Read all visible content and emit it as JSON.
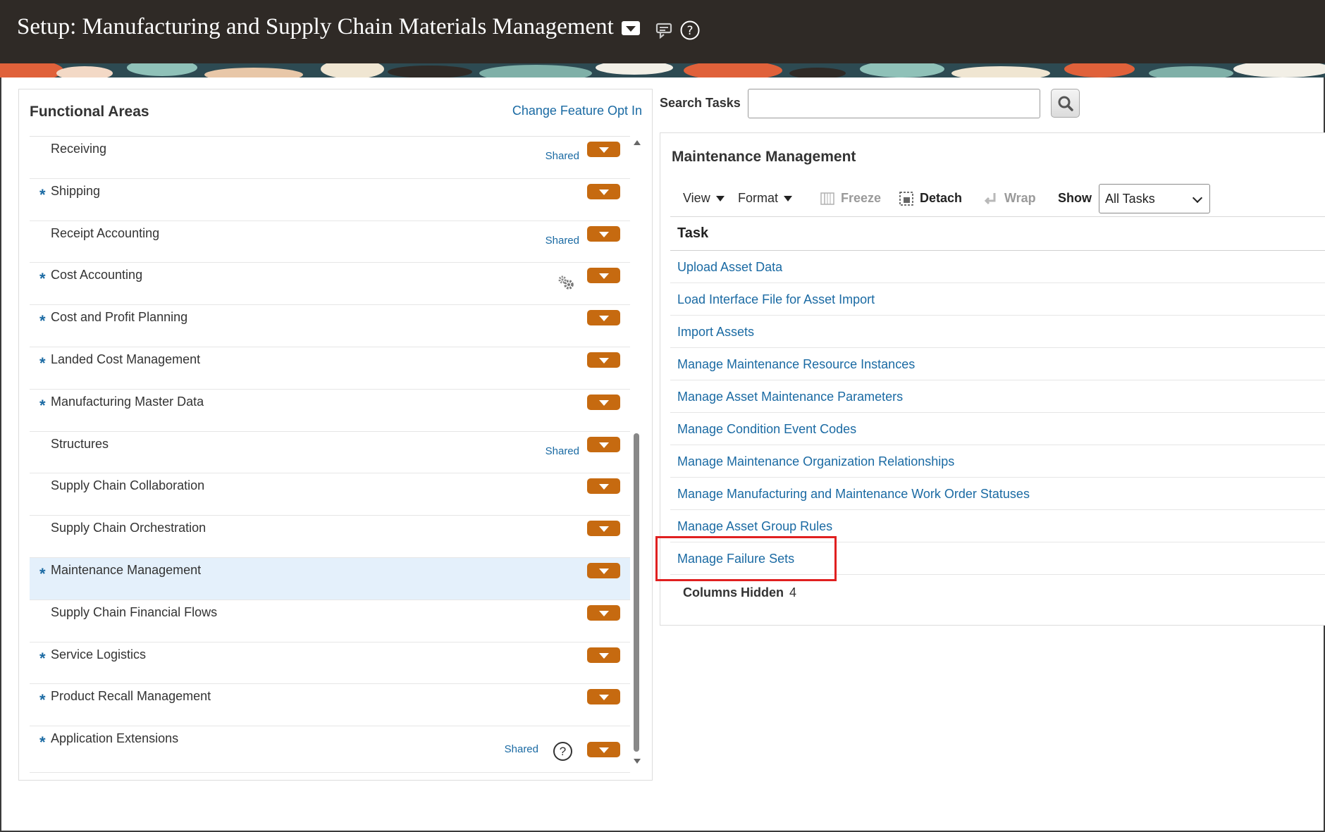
{
  "header": {
    "title": "Setup: Manufacturing and Supply Chain Materials Management",
    "title_dropdown_icon": "caret-down-icon",
    "icons": [
      "tray-icon",
      "help-icon"
    ]
  },
  "functional_areas": {
    "title": "Functional Areas",
    "change_link": "Change Feature Opt In",
    "shared_label": "Shared",
    "items": [
      {
        "label": "Receiving",
        "required": "",
        "shared": "Shared"
      },
      {
        "label": "Shipping",
        "required": "*",
        "shared": ""
      },
      {
        "label": "Receipt Accounting",
        "required": "",
        "shared": "Shared"
      },
      {
        "label": "Cost Accounting",
        "required": "*",
        "shared": ""
      },
      {
        "label": "Cost and Profit Planning",
        "required": "*",
        "shared": ""
      },
      {
        "label": "Landed Cost Management",
        "required": "*",
        "shared": ""
      },
      {
        "label": "Manufacturing Master Data",
        "required": "*",
        "shared": ""
      },
      {
        "label": "Structures",
        "required": "",
        "shared": "Shared"
      },
      {
        "label": "Supply Chain Collaboration",
        "required": "",
        "shared": ""
      },
      {
        "label": "Supply Chain Orchestration",
        "required": "",
        "shared": ""
      },
      {
        "label": "Maintenance Management",
        "required": "*",
        "shared": "",
        "selected": true
      },
      {
        "label": "Supply Chain Financial Flows",
        "required": "",
        "shared": ""
      },
      {
        "label": "Service Logistics",
        "required": "*",
        "shared": ""
      },
      {
        "label": "Product Recall Management",
        "required": "*",
        "shared": ""
      },
      {
        "label": "Application Extensions",
        "required": "*",
        "shared": "Shared"
      }
    ]
  },
  "search": {
    "label": "Search Tasks",
    "value": "",
    "placeholder": ""
  },
  "task_panel": {
    "title": "Maintenance Management",
    "toolbar": {
      "view": "View",
      "format": "Format",
      "freeze": "Freeze",
      "detach": "Detach",
      "wrap": "Wrap",
      "show_label": "Show",
      "show_value": "All Tasks"
    },
    "column_header": "Task",
    "tasks": [
      "Upload Asset Data",
      "Load Interface File for Asset Import",
      "Import Assets",
      "Manage Maintenance Resource Instances",
      "Manage Asset Maintenance Parameters",
      "Manage Condition Event Codes",
      "Manage Maintenance Organization Relationships",
      "Manage Manufacturing and Maintenance Work Order Statuses",
      "Manage Asset Group Rules",
      "Manage Failure Sets"
    ],
    "columns_hidden_label": "Columns Hidden",
    "columns_hidden_count": "4"
  },
  "colors": {
    "header_bg": "#2f2a26",
    "link": "#1a6aa3",
    "dropdown_button": "#c66a10",
    "selected_row": "#e4f0fb",
    "highlight": "#e02020"
  }
}
